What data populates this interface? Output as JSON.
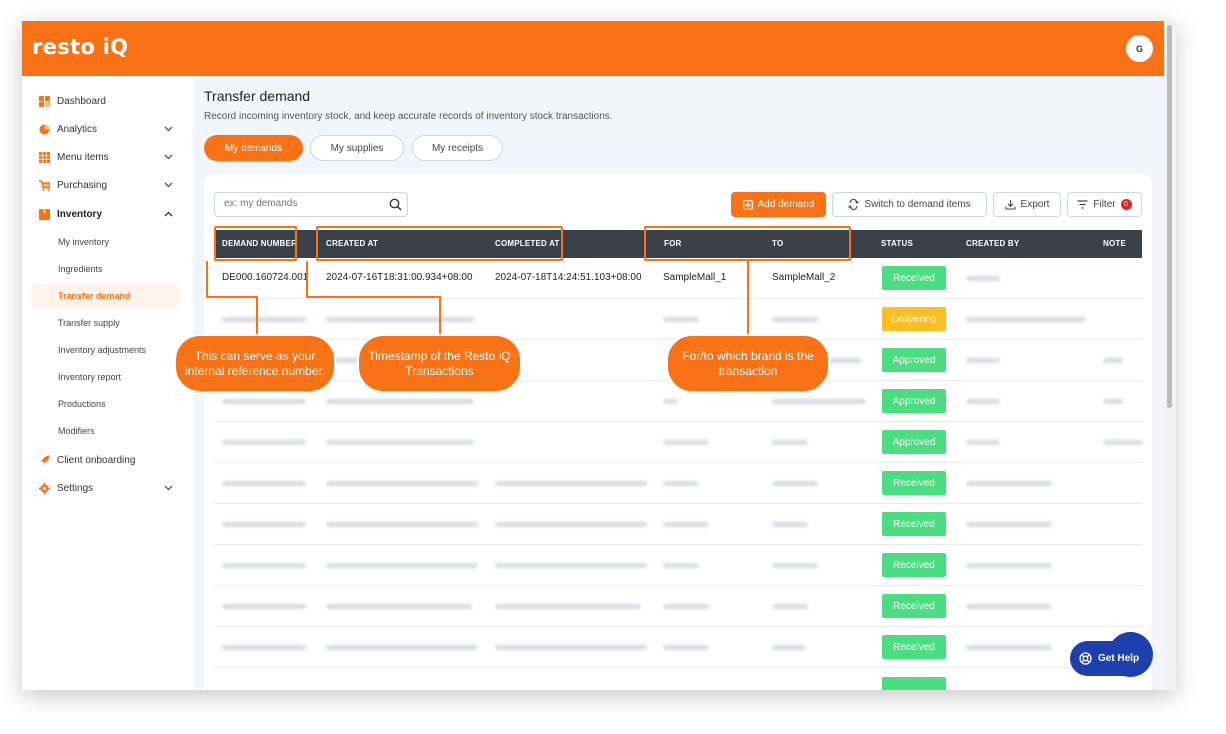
{
  "app": {
    "logo": "resto iQ",
    "avatar_initial": "G",
    "brand_color": "#f97316"
  },
  "sidebar": {
    "items": [
      {
        "label": "Dashboard",
        "icon": "dashboard-icon"
      },
      {
        "label": "Analytics",
        "icon": "pie-chart-icon",
        "chevron": "⌄"
      },
      {
        "label": "Menu items",
        "icon": "grid-icon",
        "chevron": "⌄"
      },
      {
        "label": "Purchasing",
        "icon": "cart-icon",
        "chevron": "⌄"
      },
      {
        "label": "Inventory",
        "icon": "box-icon",
        "chevron": "⌃"
      }
    ],
    "subitems": [
      "My inventory",
      "Ingredients",
      "Transfer demand",
      "Transfer supply",
      "Inventory adjustments",
      "Inventory report",
      "Productions",
      "Modifiers"
    ],
    "bottom": [
      {
        "label": "Client onboarding",
        "icon": "rocket-icon"
      },
      {
        "label": "Settings",
        "icon": "gear-icon",
        "chevron": "⌄"
      }
    ]
  },
  "page": {
    "title": "Transfer demand",
    "subtitle": "Record incoming inventory stock, and keep accurate records of inventory stock transactions.",
    "tabs": [
      "My demands",
      "My supplies",
      "My receipts"
    ]
  },
  "toolbar": {
    "search_placeholder": "ex: my demands",
    "add_label": "Add demand",
    "switch_label": "Switch to demand items",
    "export_label": "Export",
    "filter_label": "Filter",
    "filter_count": "0"
  },
  "table": {
    "headers": [
      "DEMAND NUMBER",
      "CREATED AT",
      "COMPLETED AT",
      "FOR",
      "TO",
      "STATUS",
      "CREATED BY",
      "NOTE"
    ],
    "first_row": {
      "demand_number": "DE000.160724.001",
      "created_at": "2024-07-16T18:31:00.934+08:00",
      "completed_at": "2024-07-18T14:24:51.103+08:00",
      "for": "SampleMall_1",
      "to": "SampleMall_2",
      "status": "Received"
    },
    "statuses": [
      "Received",
      "Delivering",
      "Approved",
      "Approved",
      "Approved",
      "Received",
      "Received",
      "Received",
      "Received",
      "Received"
    ]
  },
  "callouts": {
    "demand_number": "This can serve as your internal reference number.",
    "timestamp": "Timestamp of the Resto iQ Transactions",
    "brand": "For/to which brand is the transaction"
  },
  "help": {
    "label": "Get Help"
  }
}
